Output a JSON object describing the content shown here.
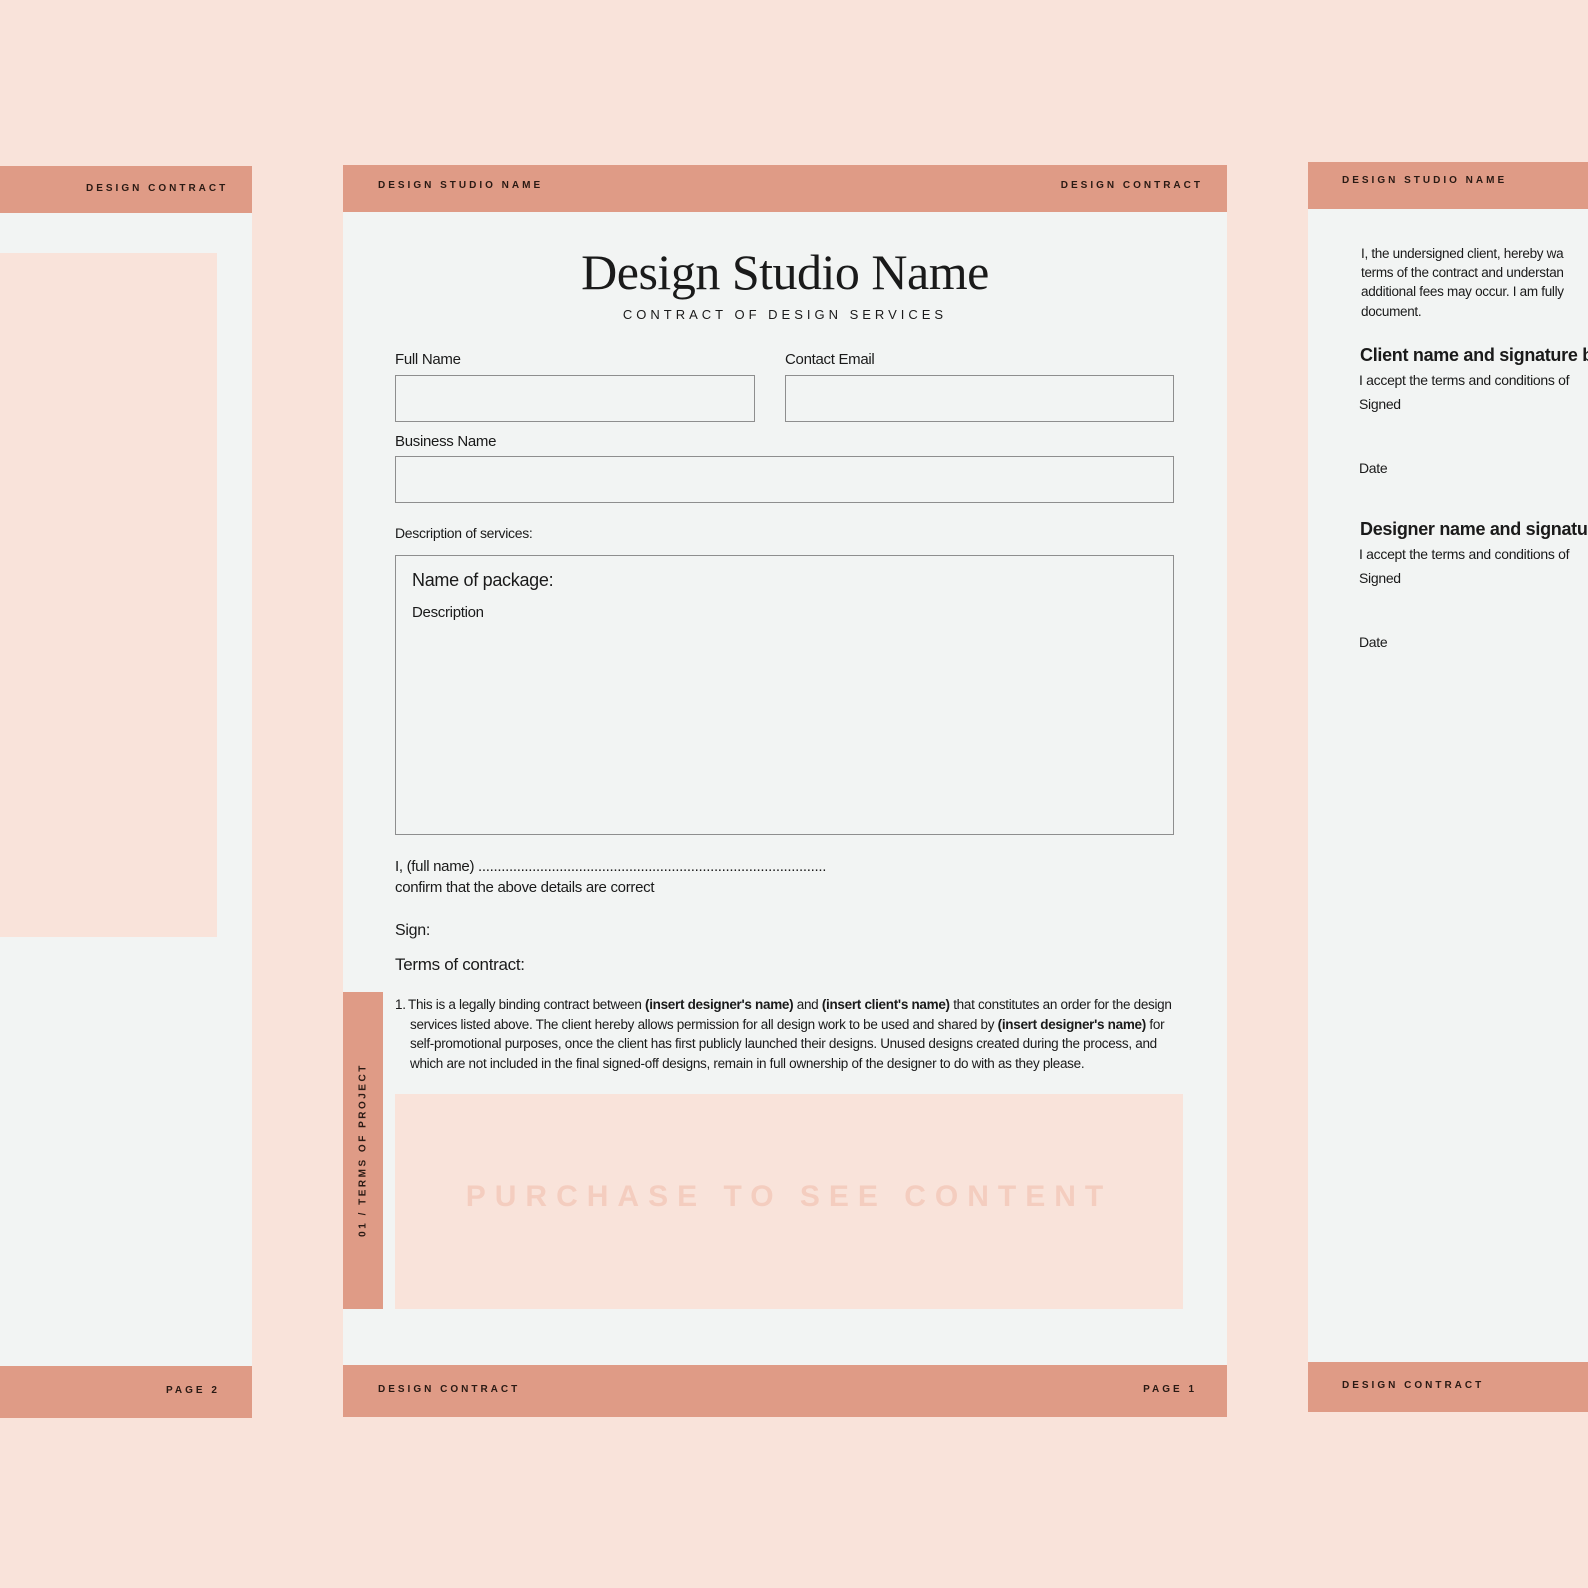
{
  "pages": {
    "left": {
      "header": "DESIGN CONTRACT",
      "footer_page": "PAGE 2"
    },
    "center": {
      "header_left": "DESIGN STUDIO NAME",
      "header_right": "DESIGN CONTRACT",
      "title": "Design Studio Name",
      "subtitle": "CONTRACT OF DESIGN SERVICES",
      "fields": {
        "full_name_label": "Full Name",
        "contact_email_label": "Contact Email",
        "business_name_label": "Business Name"
      },
      "description_label": "Description of services:",
      "package_name": "Name of package:",
      "package_description": "Description",
      "confirm_line1": "I, (full name) ..........................................................................................",
      "confirm_line2": "confirm that the above details are correct",
      "sign_label": "Sign:",
      "terms_heading": "Terms of contract:",
      "terms": {
        "number": "1.",
        "t1": "This is a legally binding contract between ",
        "b1": "(insert designer's name)",
        "t2": " and ",
        "b2": "(insert client's name)",
        "t3": " that constitutes an order for the design services listed above. The client hereby allows permission for all design work to be used and shared by ",
        "b3": "(insert designer's name)",
        "t4": " for self-promotional purposes, once the client has first publicly launched their designs. Unused designs created during the process, and which are not included in the final signed-off designs, remain in full ownership of the designer to do with as they please."
      },
      "side_tab": "01 / TERMS OF PROJECT",
      "locked_text": "PURCHASE TO SEE CONTENT",
      "footer_left": "DESIGN CONTRACT",
      "footer_page": "PAGE 1"
    },
    "right": {
      "header": "DESIGN STUDIO NAME",
      "para_lines": [
        "I, the undersigned client, hereby wa",
        "terms of the contract and understan",
        "additional fees may occur. I am fully",
        "document."
      ],
      "client_heading": "Client name and signature b",
      "client_accept": "I accept the terms and conditions of",
      "client_signed": "Signed",
      "client_date": "Date",
      "designer_heading": "Designer name and signatur",
      "designer_accept": "I accept the terms and conditions of",
      "designer_signed": "Signed",
      "designer_date": "Date",
      "footer": "DESIGN CONTRACT"
    }
  },
  "colors": {
    "background": "#f9e3da",
    "band": "#df9b86",
    "paper": "#f2f4f3",
    "locked_text": "#f4cdbf"
  }
}
